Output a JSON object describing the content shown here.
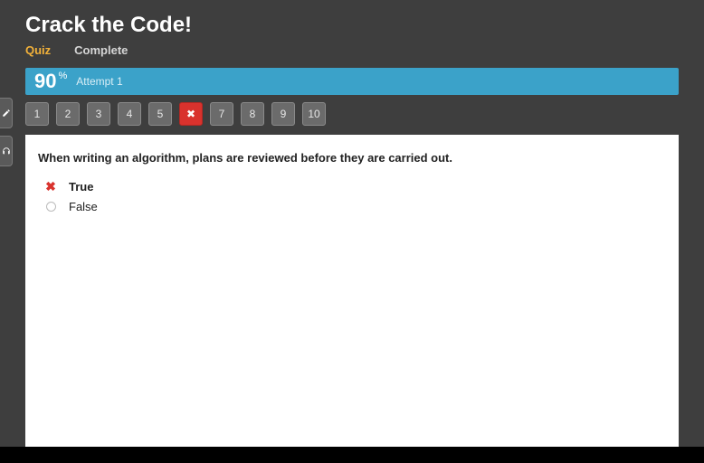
{
  "header": {
    "title": "Crack the Code!",
    "tabs": [
      {
        "label": "Quiz",
        "active": true
      },
      {
        "label": "Complete",
        "active": false
      }
    ]
  },
  "scorebar": {
    "score": "90",
    "unit": "%",
    "attempt": "Attempt 1"
  },
  "questions_nav": [
    {
      "label": "1",
      "state": "normal"
    },
    {
      "label": "2",
      "state": "normal"
    },
    {
      "label": "3",
      "state": "normal"
    },
    {
      "label": "4",
      "state": "normal"
    },
    {
      "label": "5",
      "state": "normal"
    },
    {
      "label": "✖",
      "state": "wrong"
    },
    {
      "label": "7",
      "state": "normal"
    },
    {
      "label": "8",
      "state": "normal"
    },
    {
      "label": "9",
      "state": "normal"
    },
    {
      "label": "10",
      "state": "normal"
    }
  ],
  "question": {
    "text": "When writing an algorithm, plans are reviewed before they are carried out.",
    "options": [
      {
        "label": "True",
        "mark": "x",
        "bold": true
      },
      {
        "label": "False",
        "mark": "radio",
        "bold": false
      }
    ]
  }
}
